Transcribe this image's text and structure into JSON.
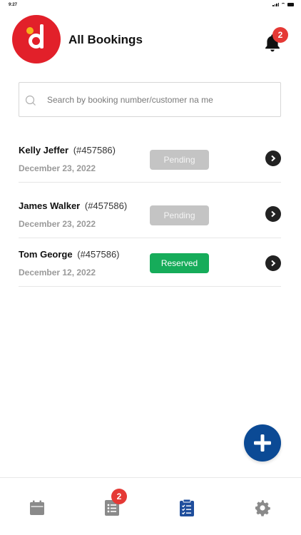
{
  "status_bar": {
    "time": "9:27"
  },
  "header": {
    "title": "All Bookings",
    "notification_count": "2"
  },
  "search": {
    "placeholder": "Search by booking number/customer na me"
  },
  "bookings": [
    {
      "name": "Kelly Jeffer",
      "number": "(#457586)",
      "date": "December 23, 2022",
      "status": "Pending"
    },
    {
      "name": "James Walker",
      "number": "(#457586)",
      "date": "December 23, 2022",
      "status": "Pending"
    },
    {
      "name": "Tom George",
      "number": "(#457586)",
      "date": "December 12, 2022",
      "status": "Reserved"
    }
  ],
  "tabbar": {
    "tabs": [
      {
        "name": "calendar",
        "icon": "calendar-icon"
      },
      {
        "name": "list",
        "icon": "list-icon",
        "badge": "2"
      },
      {
        "name": "bookings",
        "icon": "clipboard-check-icon",
        "active": true
      },
      {
        "name": "settings",
        "icon": "gear-icon"
      }
    ]
  },
  "colors": {
    "brand_red": "#e2202a",
    "badge_red": "#e53935",
    "pending": "#c4c4c4",
    "reserved": "#16ac5a",
    "fab_blue": "#0b4a95",
    "active_tab": "#1f4e9c",
    "inactive_tab": "#8a8a8a"
  }
}
